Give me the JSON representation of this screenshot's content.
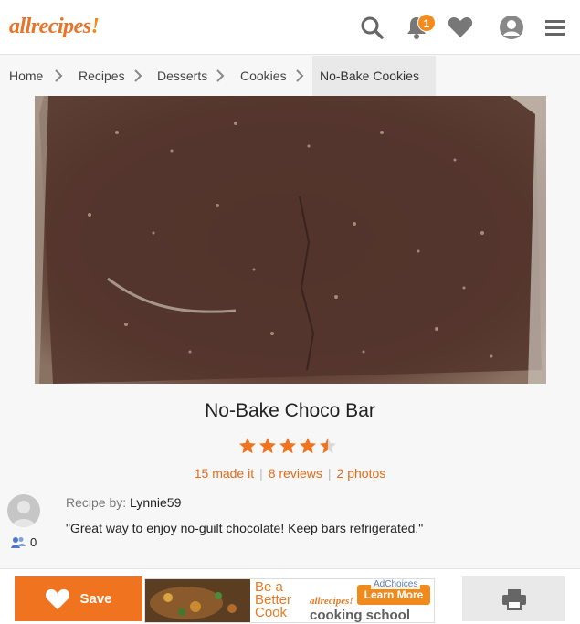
{
  "header": {
    "logo_text": "allrecipes",
    "logo_bang": "!",
    "notification_count": "1",
    "accent_color": "#f0731f"
  },
  "breadcrumb": {
    "items": [
      "Home",
      "Recipes",
      "Desserts",
      "Cookies",
      "No-Bake Cookies"
    ]
  },
  "recipe": {
    "title": "No-Bake Choco Bar",
    "rating": 4.5,
    "rating_max": 5,
    "made_it": "15 made it",
    "reviews": "8 reviews",
    "photos": "2 photos",
    "recipe_by_label": "Recipe by:",
    "author": "Lynnie59",
    "followers": "0",
    "description": "\"Great way to enjoy no-guilt chocolate! Keep bars refrigerated.\""
  },
  "bottom_bar": {
    "save_label": "Save",
    "ad": {
      "line1": "Be a",
      "line2": "Better",
      "line3": "Cook",
      "brand": "allrecipes!",
      "school": "cooking school",
      "cta": "Learn More",
      "adchoices": "AdChoices"
    }
  }
}
